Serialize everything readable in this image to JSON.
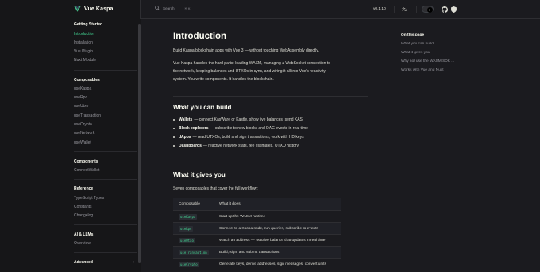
{
  "nav": {
    "logo_text": "Vue Kaspa",
    "search_label": "Search",
    "search_kbd": "⌘ K",
    "version": "v0.1.10",
    "lang_icon": "translate-icon",
    "accent": "#42d392"
  },
  "sidebar": {
    "sections": [
      {
        "title": "Getting Started",
        "items": [
          "Introduction",
          "Installation",
          "Vue Plugin",
          "Nuxt Module"
        ]
      },
      {
        "title": "Composables",
        "items": [
          "useKaspa",
          "useRpc",
          "useUtxo",
          "useTransaction",
          "useCrypto",
          "useNetwork",
          "useWallet"
        ]
      },
      {
        "title": "Components",
        "items": [
          "ConnectWallet"
        ]
      },
      {
        "title": "Reference",
        "items": [
          "TypeScript Types",
          "Constants",
          "Changelog"
        ]
      },
      {
        "title": "AI & LLMs",
        "items": [
          "Overview"
        ]
      },
      {
        "title": "Advanced",
        "items": []
      }
    ],
    "active_item": "Introduction"
  },
  "content": {
    "title": "Introduction",
    "intro": "Build Kaspa blockchain apps with Vue 3 — without touching WebAssembly directly.",
    "para_line1": "Vue Kaspa handles the hard parts: loading WASM, managing a WebSocket connection to",
    "para_line2": "the network, keeping balances and UTXOs in sync, and wiring it all into Vue's reactivity",
    "para_line3": "system. You write components. It handles the blockchain.",
    "h2_build": "What you can build",
    "build_items": [
      {
        "term": "Wallets",
        "desc": "— connect KasWare or Kastle, show live balances, send KAS"
      },
      {
        "term": "Block explorers",
        "desc": "— subscribe to new blocks and DAG events in real time"
      },
      {
        "term": "dApps",
        "desc": "— read UTXOs, build and sign transactions, work with HD keys"
      },
      {
        "term": "Dashboards",
        "desc": "— reactive network stats, fee estimates, UTXO history"
      }
    ],
    "h2_gives": "What it gives you",
    "gives_intro": "Seven composables that cover the full workflow:",
    "table_headers": [
      "Composable",
      "What it does"
    ],
    "table_rows": [
      {
        "code": "useKaspa",
        "desc": "Start up the WASM runtime"
      },
      {
        "code": "useRpc",
        "desc": "Connect to a Kaspa node, run queries, subscribe to events"
      },
      {
        "code": "useUtxo",
        "desc": "Watch an address — reactive balance that updates in real time"
      },
      {
        "code": "useTransaction",
        "desc": "Build, sign, and submit transactions"
      },
      {
        "code": "useCrypto",
        "desc": "Generate keys, derive addresses, sign messages, convert units"
      }
    ]
  },
  "toc": {
    "title": "On this page",
    "items": [
      "What you can build",
      "What it gives you",
      "Why not use the WASM SDK ...",
      "Works with Vue and Nuxt"
    ]
  }
}
